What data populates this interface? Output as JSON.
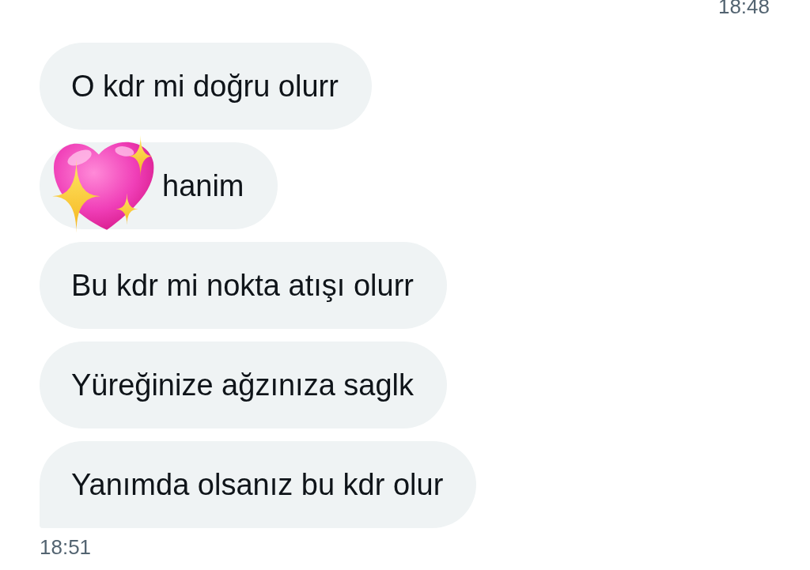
{
  "header": {
    "time": "18:48"
  },
  "messages": [
    {
      "kind": "text",
      "text": "O kdr mi doğru olurr"
    },
    {
      "kind": "emoji_text",
      "text": "hanim"
    },
    {
      "kind": "text",
      "text": "Bu kdr mi nokta atışı olurr"
    },
    {
      "kind": "text",
      "text": "Yüreğinize ağzınıza saglk"
    },
    {
      "kind": "text",
      "text": "Yanımda olsanız bu kdr olur"
    }
  ],
  "footer": {
    "time": "18:51"
  }
}
